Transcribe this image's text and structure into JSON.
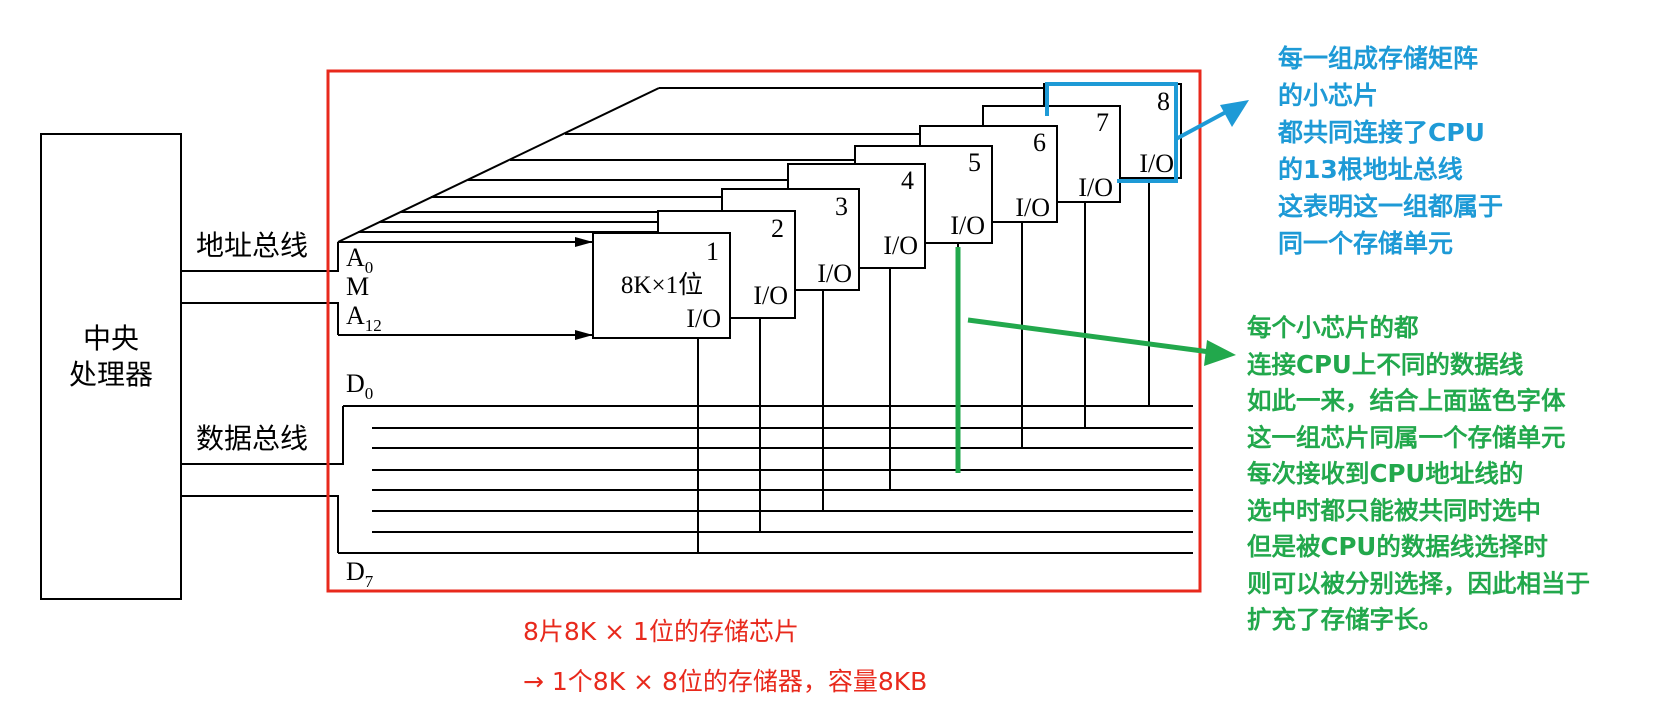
{
  "cpu": {
    "label_line1": "中央",
    "label_line2": "处理器"
  },
  "address_bus_label": "地址总线",
  "data_bus_label": "数据总线",
  "address_lines": {
    "a0_base": "A",
    "a0_sub": "0",
    "m": "M",
    "a12_base": "A",
    "a12_sub": "12"
  },
  "data_lines": {
    "d0_base": "D",
    "d0_sub": "0",
    "d7_base": "D",
    "d7_sub": "7"
  },
  "chips": [
    {
      "number": "1",
      "size_label": "8K×1位",
      "io": "I/O"
    },
    {
      "number": "2",
      "io": "I/O"
    },
    {
      "number": "3",
      "io": "I/O"
    },
    {
      "number": "4",
      "io": "I/O"
    },
    {
      "number": "5",
      "io": "I/O"
    },
    {
      "number": "6",
      "io": "I/O"
    },
    {
      "number": "7",
      "io": "I/O"
    },
    {
      "number": "8",
      "io": "I/O"
    }
  ],
  "blue_note": [
    "每一组成存储矩阵",
    "的小芯片",
    "都共同连接了CPU",
    "的13根地址总线",
    "这表明这一组都属于",
    "同一个存储单元"
  ],
  "green_note": [
    "每个小芯片的都",
    "连接CPU上不同的数据线",
    "如此一来，结合上面蓝色字体",
    "这一组芯片同属一个存储单元",
    "每次接收到CPU地址线的",
    "选中时都只能被共同时选中",
    "但是被CPU的数据线选择时",
    "则可以被分别选择，因此相当于",
    "扩充了存储字长。"
  ],
  "caption_line1": "8片8K × 1位的存储芯片",
  "caption_line2": "→  1个8K × 8位的存储器，容量8KB",
  "colors": {
    "red_frame": "#e8291c",
    "blue_annotation": "#1e9ad6",
    "green_annotation": "#22a84c",
    "line": "#000000"
  }
}
